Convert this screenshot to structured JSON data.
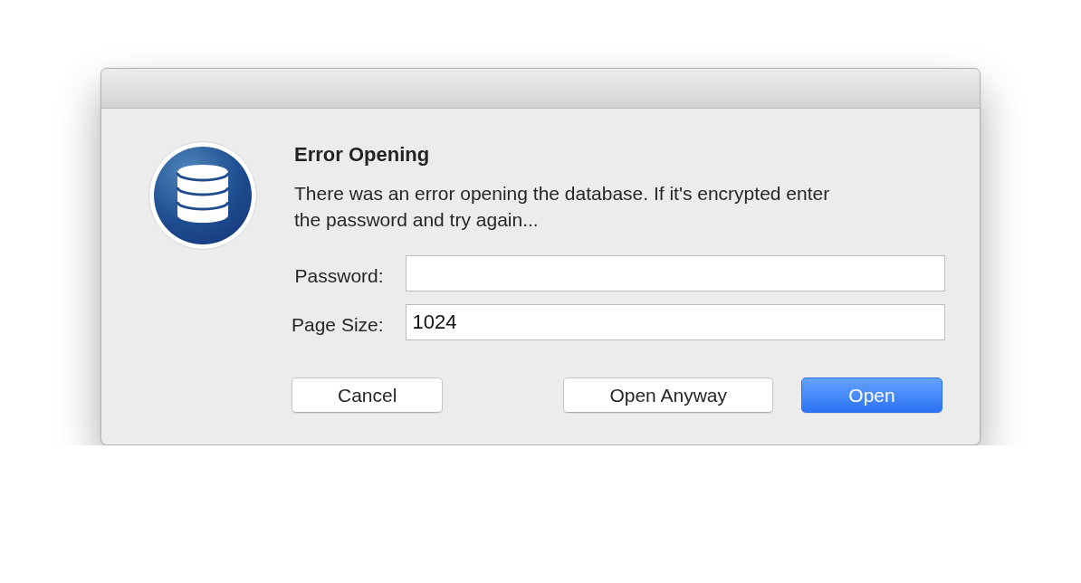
{
  "dialog": {
    "title": "Error Opening",
    "message": "There was an error opening the database. If it's encrypted enter the password and try again...",
    "fields": [
      {
        "label": "Password:"
      },
      {
        "label": "Page Size:",
        "value": "1024"
      }
    ],
    "buttons": [
      {
        "label": "Cancel",
        "default": false
      },
      {
        "label": "Open Anyway",
        "default": false
      },
      {
        "label": "Open",
        "default": true
      }
    ]
  }
}
